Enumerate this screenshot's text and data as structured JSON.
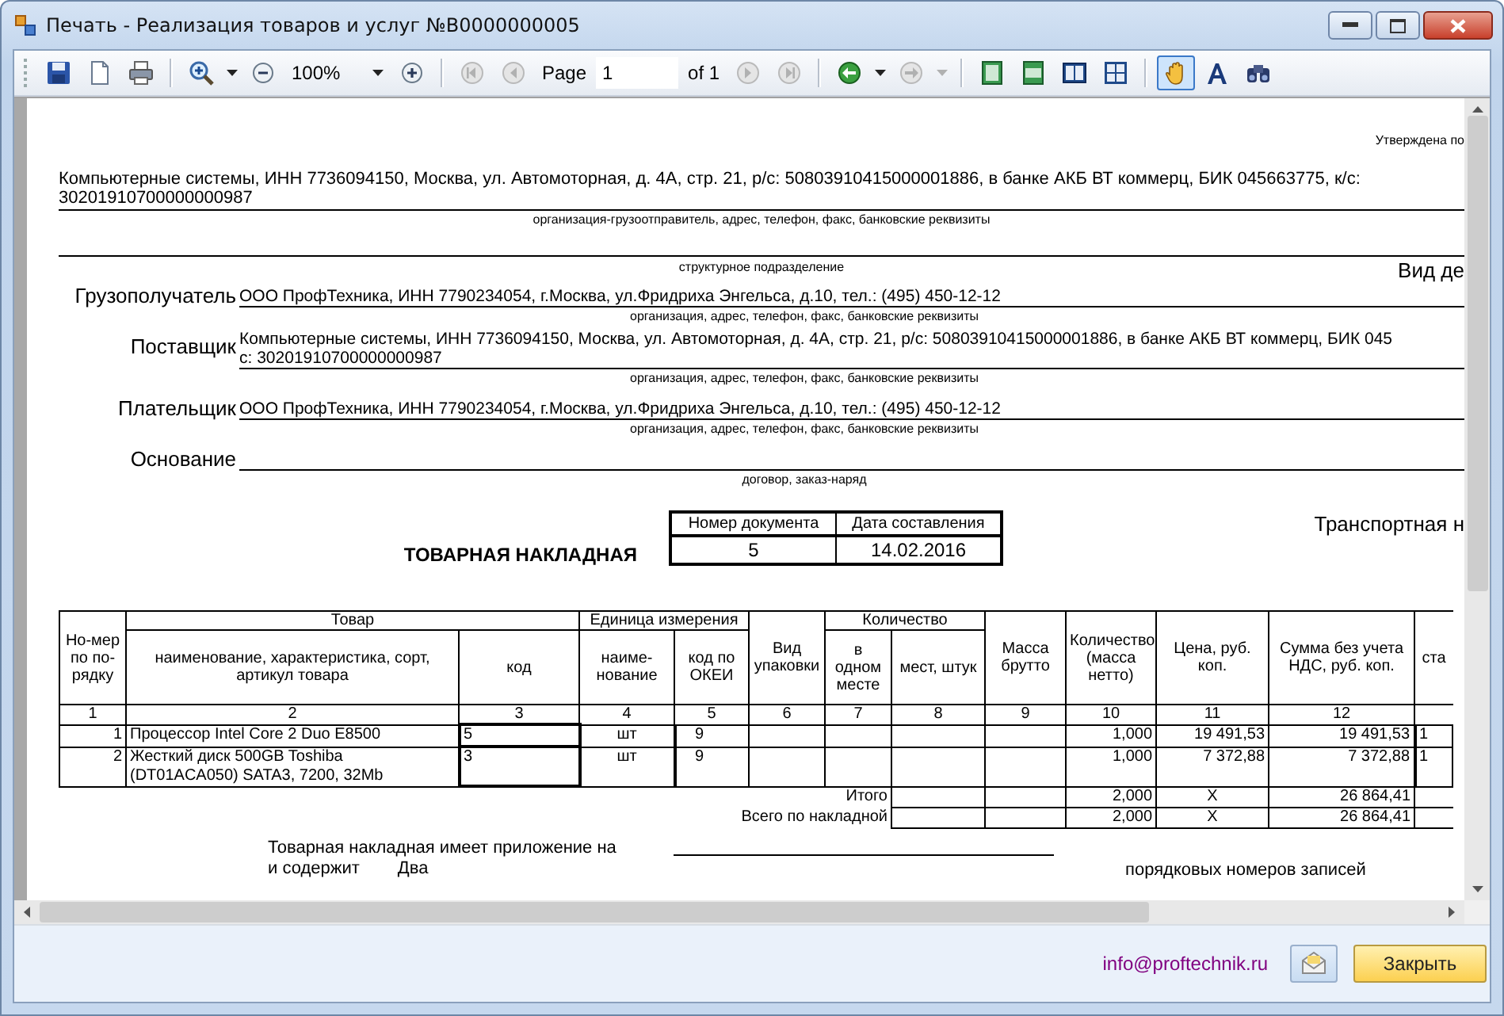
{
  "window": {
    "title": "Печать - Реализация товаров и услуг №В0000000005"
  },
  "toolbar": [
    {
      "kind": "save"
    },
    {
      "kind": "new"
    },
    {
      "kind": "print"
    },
    {
      "kind": "separator"
    },
    {
      "kind": "zoom-in"
    },
    {
      "kind": "dropdown",
      "disabled": false
    },
    {
      "kind": "zoom-out"
    },
    {
      "kind": "zoom-field",
      "value": "100%"
    },
    {
      "kind": "zoom-plus"
    },
    {
      "kind": "separator"
    },
    {
      "kind": "first",
      "disabled": true
    },
    {
      "kind": "prev",
      "disabled": true
    },
    {
      "kind": "label",
      "text": "Page"
    },
    {
      "kind": "page-field",
      "value": "1"
    },
    {
      "kind": "label",
      "text": "of 1"
    },
    {
      "kind": "next",
      "disabled": true
    },
    {
      "kind": "last",
      "disabled": true
    },
    {
      "kind": "separator"
    },
    {
      "kind": "back",
      "disabled": false
    },
    {
      "kind": "dropdown",
      "disabled": false
    },
    {
      "kind": "forward",
      "disabled": true
    },
    {
      "kind": "dropdown",
      "disabled": true
    },
    {
      "kind": "separator"
    },
    {
      "kind": "page-single"
    },
    {
      "kind": "page-width"
    },
    {
      "kind": "page-double"
    },
    {
      "kind": "page-grid"
    },
    {
      "kind": "separator"
    },
    {
      "kind": "pan",
      "selected": true
    },
    {
      "kind": "text-select",
      "selected": false
    },
    {
      "kind": "find"
    }
  ],
  "document": {
    "approved": "Утверждена по",
    "shipper": "Компьютерные системы, ИНН 7736094150, Москва, ул. Автомоторная, д. 4А, стр. 21, р/с: 50803910415000001886, в банке АКБ ВТ коммерц, БИК 045663775, к/с: 30201910700000000987",
    "shipper_caption": "организация-грузоотправитель, адрес, телефон, факс, банковские реквизиты",
    "division_caption": "структурное подразделение",
    "activity": "Вид де",
    "parties": [
      {
        "label": "Грузополучатель",
        "value": "ООО ПрофТехника, ИНН 7790234054, г.Москва, ул.Фридриха Энгельса, д.10, тел.: (495) 450-12-12",
        "caption": "организация, адрес, телефон, факс, банковские реквизиты"
      },
      {
        "label": "Поставщик",
        "value": "Компьютерные системы, ИНН 7736094150, Москва, ул. Автомоторная, д. 4А, стр. 21, р/с: 50803910415000001886, в банке АКБ ВТ коммерц, БИК 045",
        "value_line_2": "с: 30201910700000000987",
        "caption": "организация, адрес, телефон, факс, банковские реквизиты"
      },
      {
        "label": "Плательщик",
        "value": "ООО ПрофТехника, ИНН 7790234054, г.Москва, ул.Фридриха Энгельса, д.10, тел.: (495) 450-12-12",
        "caption": "организация, адрес, телефон, факс, банковские реквизиты"
      },
      {
        "label": "Основание",
        "caption": "договор, заказ-наряд"
      }
    ],
    "title": "ТОВАРНАЯ НАКЛАДНАЯ",
    "doc_box": {
      "number_label": "Номер документа",
      "date_label": "Дата составления",
      "number": "5",
      "date": "14.02.2016"
    },
    "transport": "Транспортная н",
    "table": {
      "columns": [
        {
          "label": "Но-мер по по-рядку",
          "number": "1"
        },
        {
          "group": "Товар",
          "columns": [
            {
              "label": "наименование, характеристика, сорт, артикул товара",
              "number": "2"
            },
            {
              "label": "код",
              "number": "3"
            }
          ]
        },
        {
          "group": "Единица измерения",
          "columns": [
            {
              "label": "наиме-нование",
              "number": "4"
            },
            {
              "label": "код по ОКЕИ",
              "number": "5"
            }
          ]
        },
        {
          "label": "Вид упаковки",
          "number": "6"
        },
        {
          "group": "Количество",
          "columns": [
            {
              "label": "в одном месте",
              "number": "7"
            },
            {
              "label": "мест, штук",
              "number": "8"
            }
          ]
        },
        {
          "label": "Масса брутто",
          "number": "9"
        },
        {
          "label": "Количество (масса нетто)",
          "number": "10"
        },
        {
          "label": "Цена, руб. коп.",
          "number": "11"
        },
        {
          "label": "Сумма без учета НДС, руб. коп.",
          "number": "12"
        },
        {
          "label": "ста"
        }
      ],
      "rows": [
        {
          "number": "1",
          "name": "Процессор Intel Core 2 Duo E8500",
          "code": "5",
          "unit": "шт",
          "okei": "9",
          "net": "1,000",
          "price": "19 491,53",
          "sum": "19 491,53",
          "column_13": "1"
        },
        {
          "number": "2",
          "name": "Жесткий диск 500GB Toshiba (DT01ACA050) SATA3, 7200, 32Mb",
          "code": "3",
          "unit": "шт",
          "okei": "9",
          "net": "1,000",
          "price": "7 372,88",
          "sum": "7 372,88",
          "column_13": "1"
        }
      ],
      "totals": [
        {
          "label": "Итого",
          "net": "2,000",
          "price": "Х",
          "sum": "26 864,41"
        },
        {
          "label": "Всего по накладной",
          "net": "2,000",
          "price": "Х",
          "sum": "26 864,41"
        }
      ]
    },
    "appendix": "Товарная накладная имеет приложение на",
    "contains": "и содержит",
    "count_words": "Два",
    "records": "порядковых номеров записей"
  },
  "footer": {
    "email": "info@proftechnik.ru",
    "close": "Закрыть"
  }
}
